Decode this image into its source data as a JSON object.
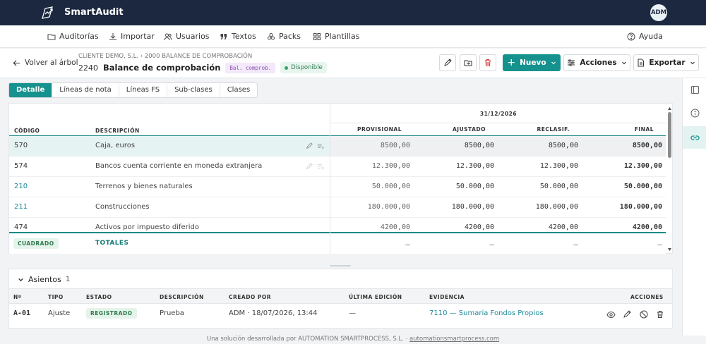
{
  "app": {
    "brand": "SmartAudit",
    "avatar": "ADM"
  },
  "nav": [
    {
      "label": "Auditorías",
      "icon": "folder-icon"
    },
    {
      "label": "Importar",
      "icon": "download-icon"
    },
    {
      "label": "Usuarios",
      "icon": "users-icon"
    },
    {
      "label": "Textos",
      "icon": "quote-icon"
    },
    {
      "label": "Packs",
      "icon": "packs-icon"
    },
    {
      "label": "Plantillas",
      "icon": "grid-icon"
    }
  ],
  "help": "Ayuda",
  "header": {
    "back": "Volver al árbol",
    "breadcrumb": "CLIENTE DEMO, S.L. › 2000 BALANCE DE COMPROBACIÓN",
    "code": "2240",
    "title": "Balance de comprobación",
    "tag": "Bal. comprob.",
    "status": "Disponible",
    "new_btn": "Nuevo",
    "actions_btn": "Acciones",
    "export_btn": "Exportar"
  },
  "tabs": [
    "Detalle",
    "Líneas de nota",
    "Líneas FS",
    "Sub-clases",
    "Clases"
  ],
  "table": {
    "date": "31/12/2026",
    "headers": {
      "code": "CÓDIGO",
      "desc": "DESCRIPCIÓN",
      "prov": "PROVISIONAL",
      "adj": "AJUSTADO",
      "recl": "RECLASIF.",
      "final": "FINAL"
    },
    "rows": [
      {
        "code": "570",
        "desc": "Caja, euros",
        "prov": "8500,00",
        "adj": "8500,00",
        "recl": "8500,00",
        "final": "8500,00"
      },
      {
        "code": "574",
        "desc": "Bancos cuenta corriente en moneda extranjera",
        "prov": "12.300,00",
        "adj": "12.300,00",
        "recl": "12.300,00",
        "final": "12.300,00"
      },
      {
        "code": "210",
        "desc": "Terrenos y bienes naturales",
        "prov": "50.000,00",
        "adj": "50.000,00",
        "recl": "50.000,00",
        "final": "50.000,00"
      },
      {
        "code": "211",
        "desc": "Construcciones",
        "prov": "180.000,00",
        "adj": "180.000,00",
        "recl": "180.000,00",
        "final": "180.000,00"
      },
      {
        "code": "474",
        "desc": "Activos por impuesto diferido",
        "prov": "4200,00",
        "adj": "4200,00",
        "recl": "4200,00",
        "final": "4200,00"
      }
    ],
    "totals": {
      "badge": "CUADRADO",
      "label": "TOTALES",
      "prov": "–",
      "adj": "–",
      "recl": "–",
      "final": "–"
    }
  },
  "asientos": {
    "title": "Asientos",
    "count": "1",
    "headers": {
      "n": "Nº",
      "tipo": "TIPO",
      "estado": "ESTADO",
      "desc": "DESCRIPCIÓN",
      "creado": "CREADO POR",
      "edicion": "ÚLTIMA EDICIÓN",
      "evidencia": "EVIDENCIA",
      "acciones": "ACCIONES"
    },
    "row": {
      "n": "A-01",
      "tipo": "Ajuste",
      "estado": "REGISTRADO",
      "desc": "Prueba",
      "creado": "ADM · 18/07/2026, 13:44",
      "edicion": "—",
      "evidencia": "7110 — Sumaria Fondos Propios"
    }
  },
  "footer": {
    "text": "Una solución desarrollada por AUTOMATION SMARTPROCESS, S.L. · ",
    "link": "automationsmartprocess.com"
  },
  "colors": {
    "navy": "#1b2840",
    "teal": "#15928d",
    "link": "#1f8a9a"
  }
}
